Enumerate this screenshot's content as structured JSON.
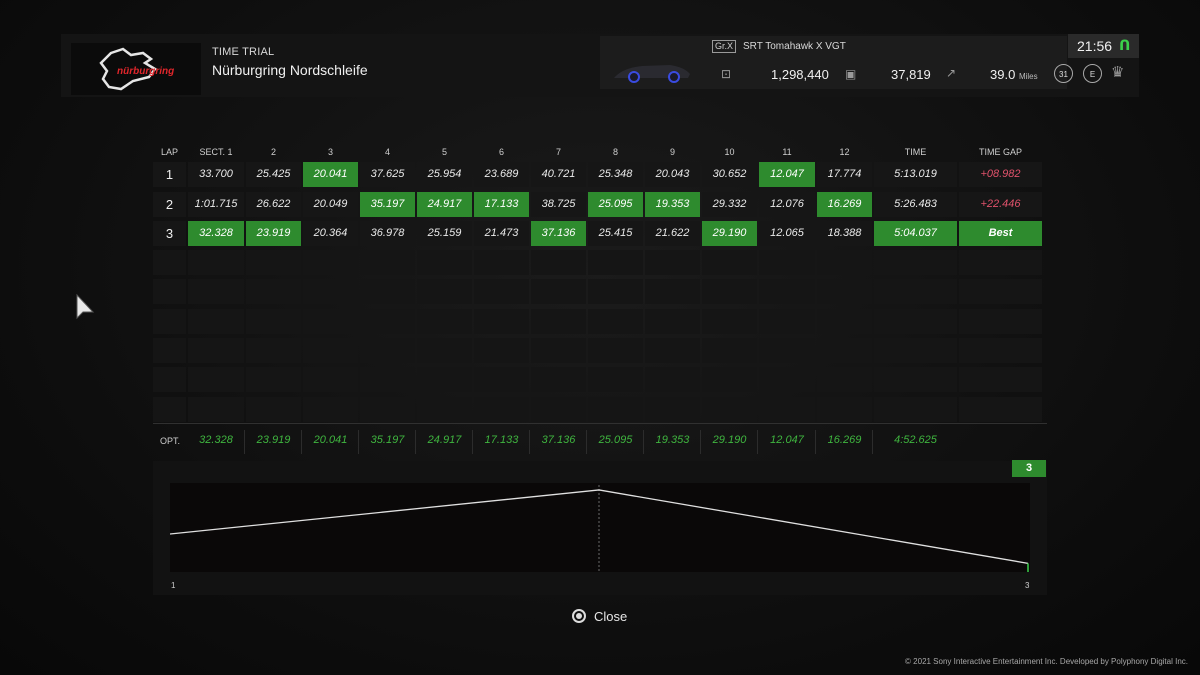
{
  "header": {
    "event_type": "TIME TRIAL",
    "track_name": "Nürburgring Nordschleife",
    "logo_text": "nürburgring"
  },
  "car": {
    "class_badge": "Gr.X",
    "name": "SRT Tomahawk X VGT",
    "credits": "1,298,440",
    "mileage_points": "37,819",
    "distance": "39.0",
    "distance_unit": "Miles",
    "level": "31"
  },
  "clock": {
    "time": "21:56"
  },
  "table": {
    "headers": [
      "LAP",
      "SECT. 1",
      "2",
      "3",
      "4",
      "5",
      "6",
      "7",
      "8",
      "9",
      "10",
      "11",
      "12",
      "TIME",
      "TIME GAP"
    ],
    "rows": [
      {
        "lap": "1",
        "sectors": [
          "33.700",
          "25.425",
          "20.041",
          "37.625",
          "25.954",
          "23.689",
          "40.721",
          "25.348",
          "20.043",
          "30.652",
          "12.047",
          "17.774"
        ],
        "highlight": [
          false,
          false,
          true,
          false,
          false,
          false,
          false,
          false,
          false,
          false,
          true,
          false
        ],
        "time": "5:13.019",
        "gap": "+08.982",
        "gap_best": false
      },
      {
        "lap": "2",
        "sectors": [
          "1:01.715",
          "26.622",
          "20.049",
          "35.197",
          "24.917",
          "17.133",
          "38.725",
          "25.095",
          "19.353",
          "29.332",
          "12.076",
          "16.269"
        ],
        "highlight": [
          false,
          false,
          false,
          true,
          true,
          true,
          false,
          true,
          true,
          false,
          false,
          true
        ],
        "time": "5:26.483",
        "gap": "+22.446",
        "gap_best": false
      },
      {
        "lap": "3",
        "sectors": [
          "32.328",
          "23.919",
          "20.364",
          "36.978",
          "25.159",
          "21.473",
          "37.136",
          "25.415",
          "21.622",
          "29.190",
          "12.065",
          "18.388"
        ],
        "highlight": [
          true,
          true,
          false,
          false,
          false,
          false,
          true,
          false,
          false,
          true,
          false,
          false
        ],
        "time": "5:04.037",
        "time_best": true,
        "gap": "Best",
        "gap_best": true
      }
    ],
    "optimal": {
      "label": "OPT.",
      "sectors": [
        "32.328",
        "23.919",
        "20.041",
        "35.197",
        "24.917",
        "17.133",
        "37.136",
        "25.095",
        "19.353",
        "29.190",
        "12.047",
        "16.269"
      ],
      "time": "4:52.625"
    }
  },
  "graph": {
    "selected_lap": "3",
    "x_start_label": "1",
    "x_end_label": "3",
    "chart_data": {
      "type": "line",
      "x": [
        1,
        2,
        3
      ],
      "values": [
        313.019,
        326.483,
        304.037
      ]
    }
  },
  "footer": {
    "close_label": "Close",
    "copyright": "© 2021 Sony Interactive Entertainment Inc. Developed by Polyphony Digital Inc."
  }
}
